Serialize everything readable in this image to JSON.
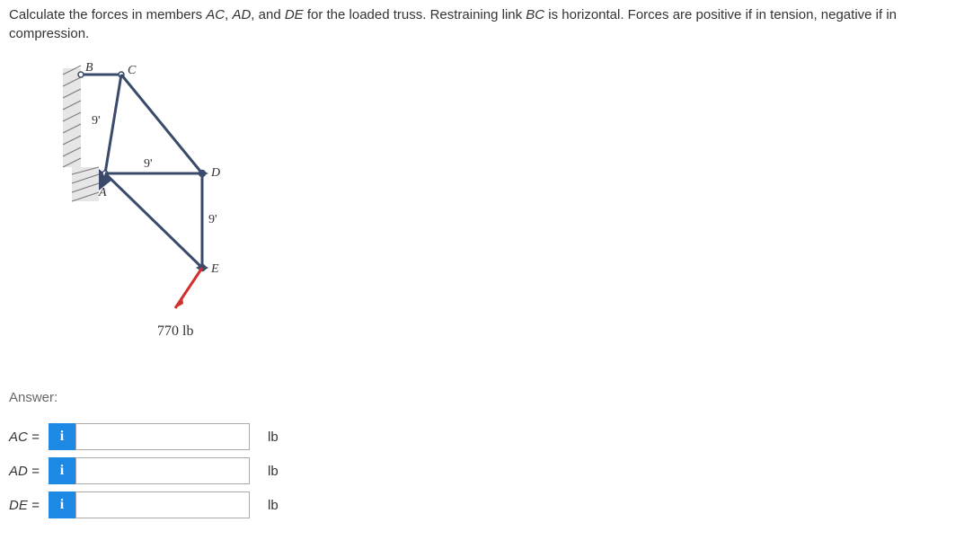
{
  "problem": {
    "text_before_vars": "Calculate the forces in members ",
    "var1": "AC",
    "sep1": ", ",
    "var2": "AD",
    "sep2": ", and ",
    "var3": "DE",
    "text_mid": " for the loaded truss. Restraining link ",
    "var4": "BC",
    "text_after": " is horizontal. Forces are positive if in tension, negative if in compression."
  },
  "figure": {
    "labels": {
      "B": "B",
      "C": "C",
      "A": "A",
      "D": "D",
      "E": "E"
    },
    "dim1": "9'",
    "dim2": "9'",
    "dim3": "9'",
    "load": "770 lb"
  },
  "answer": {
    "heading": "Answer:",
    "rows": [
      {
        "label": "AC =",
        "info": "i",
        "value": "",
        "unit": "lb"
      },
      {
        "label": "AD =",
        "info": "i",
        "value": "",
        "unit": "lb"
      },
      {
        "label": "DE =",
        "info": "i",
        "value": "",
        "unit": "lb"
      }
    ]
  }
}
